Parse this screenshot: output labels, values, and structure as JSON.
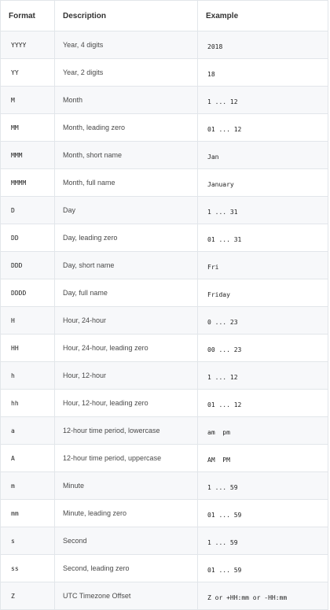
{
  "table": {
    "headers": [
      "Format",
      "Description",
      "Example"
    ],
    "rows": [
      {
        "format": "YYYY",
        "description": "Year, 4 digits",
        "example": "2018"
      },
      {
        "format": "YY",
        "description": "Year, 2 digits",
        "example": "18"
      },
      {
        "format": "M",
        "description": "Month",
        "example": "1 ... 12"
      },
      {
        "format": "MM",
        "description": "Month, leading zero",
        "example": "01 ... 12"
      },
      {
        "format": "MMM",
        "description": "Month, short name",
        "example": "Jan"
      },
      {
        "format": "MMMM",
        "description": "Month, full name",
        "example": "January"
      },
      {
        "format": "D",
        "description": "Day",
        "example": "1 ... 31"
      },
      {
        "format": "DD",
        "description": "Day, leading zero",
        "example": "01 ... 31"
      },
      {
        "format": "DDD",
        "description": "Day, short name",
        "example": "Fri"
      },
      {
        "format": "DDDD",
        "description": "Day, full name",
        "example": "Friday"
      },
      {
        "format": "H",
        "description": "Hour, 24-hour",
        "example": "0 ... 23"
      },
      {
        "format": "HH",
        "description": "Hour, 24-hour, leading zero",
        "example": "00 ... 23"
      },
      {
        "format": "h",
        "description": "Hour, 12-hour",
        "example": "1 ... 12"
      },
      {
        "format": "hh",
        "description": "Hour, 12-hour, leading zero",
        "example": "01 ... 12"
      },
      {
        "format": "a",
        "description": "12-hour time period, lowercase",
        "example": "am  pm"
      },
      {
        "format": "A",
        "description": "12-hour time period, uppercase",
        "example": "AM  PM"
      },
      {
        "format": "m",
        "description": "Minute",
        "example": "1 ... 59"
      },
      {
        "format": "mm",
        "description": "Minute, leading zero",
        "example": "01 ... 59"
      },
      {
        "format": "s",
        "description": "Second",
        "example": "1 ... 59"
      },
      {
        "format": "ss",
        "description": "Second, leading zero",
        "example": "01 ... 59"
      },
      {
        "format": "Z",
        "description": "UTC Timezone Offset",
        "example": "Z or +HH:mm or -HH:mm"
      }
    ]
  },
  "colors": {
    "border": "#e2e6ea",
    "row_alt": "#f7f8fa",
    "text": "#3b3b3b"
  }
}
